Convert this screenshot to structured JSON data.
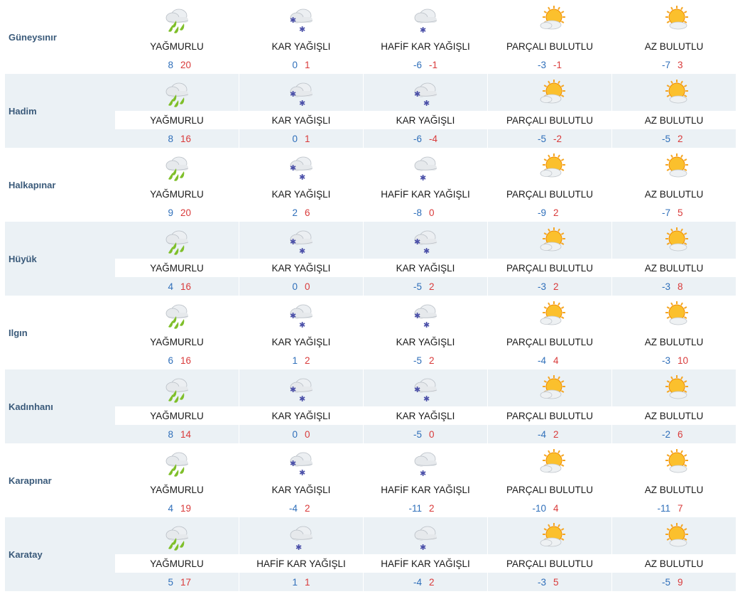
{
  "forecast": {
    "rows": [
      {
        "city": "Güneysınır",
        "days": [
          {
            "icon": "rain-icon",
            "condition": "YAĞMURLU",
            "min": "8",
            "max": "20"
          },
          {
            "icon": "snow-icon",
            "condition": "KAR YAĞIŞLI",
            "min": "0",
            "max": "1"
          },
          {
            "icon": "light-snow-icon",
            "condition": "HAFİF KAR YAĞIŞLI",
            "min": "-6",
            "max": "-1"
          },
          {
            "icon": "partly-cloudy-icon",
            "condition": "PARÇALI BULUTLU",
            "min": "-3",
            "max": "-1"
          },
          {
            "icon": "mostly-sunny-icon",
            "condition": "AZ BULUTLU",
            "min": "-7",
            "max": "3"
          }
        ]
      },
      {
        "city": "Hadim",
        "days": [
          {
            "icon": "rain-icon",
            "condition": "YAĞMURLU",
            "min": "8",
            "max": "16"
          },
          {
            "icon": "snow-icon",
            "condition": "KAR YAĞIŞLI",
            "min": "0",
            "max": "1"
          },
          {
            "icon": "snow-icon",
            "condition": "KAR YAĞIŞLI",
            "min": "-6",
            "max": "-4"
          },
          {
            "icon": "partly-cloudy-icon",
            "condition": "PARÇALI BULUTLU",
            "min": "-5",
            "max": "-2"
          },
          {
            "icon": "mostly-sunny-icon",
            "condition": "AZ BULUTLU",
            "min": "-5",
            "max": "2"
          }
        ]
      },
      {
        "city": "Halkapınar",
        "days": [
          {
            "icon": "rain-icon",
            "condition": "YAĞMURLU",
            "min": "9",
            "max": "20"
          },
          {
            "icon": "snow-icon",
            "condition": "KAR YAĞIŞLI",
            "min": "2",
            "max": "6"
          },
          {
            "icon": "light-snow-icon",
            "condition": "HAFİF KAR YAĞIŞLI",
            "min": "-8",
            "max": "0"
          },
          {
            "icon": "partly-cloudy-icon",
            "condition": "PARÇALI BULUTLU",
            "min": "-9",
            "max": "2"
          },
          {
            "icon": "mostly-sunny-icon",
            "condition": "AZ BULUTLU",
            "min": "-7",
            "max": "5"
          }
        ]
      },
      {
        "city": "Hüyük",
        "days": [
          {
            "icon": "rain-icon",
            "condition": "YAĞMURLU",
            "min": "4",
            "max": "16"
          },
          {
            "icon": "snow-icon",
            "condition": "KAR YAĞIŞLI",
            "min": "0",
            "max": "0"
          },
          {
            "icon": "snow-icon",
            "condition": "KAR YAĞIŞLI",
            "min": "-5",
            "max": "2"
          },
          {
            "icon": "partly-cloudy-icon",
            "condition": "PARÇALI BULUTLU",
            "min": "-3",
            "max": "2"
          },
          {
            "icon": "mostly-sunny-icon",
            "condition": "AZ BULUTLU",
            "min": "-3",
            "max": "8"
          }
        ]
      },
      {
        "city": "Ilgın",
        "days": [
          {
            "icon": "rain-icon",
            "condition": "YAĞMURLU",
            "min": "6",
            "max": "16"
          },
          {
            "icon": "snow-icon",
            "condition": "KAR YAĞIŞLI",
            "min": "1",
            "max": "2"
          },
          {
            "icon": "snow-icon",
            "condition": "KAR YAĞIŞLI",
            "min": "-5",
            "max": "2"
          },
          {
            "icon": "partly-cloudy-icon",
            "condition": "PARÇALI BULUTLU",
            "min": "-4",
            "max": "4"
          },
          {
            "icon": "mostly-sunny-icon",
            "condition": "AZ BULUTLU",
            "min": "-3",
            "max": "10"
          }
        ]
      },
      {
        "city": "Kadınhanı",
        "days": [
          {
            "icon": "rain-icon",
            "condition": "YAĞMURLU",
            "min": "8",
            "max": "14"
          },
          {
            "icon": "snow-icon",
            "condition": "KAR YAĞIŞLI",
            "min": "0",
            "max": "0"
          },
          {
            "icon": "snow-icon",
            "condition": "KAR YAĞIŞLI",
            "min": "-5",
            "max": "0"
          },
          {
            "icon": "partly-cloudy-icon",
            "condition": "PARÇALI BULUTLU",
            "min": "-4",
            "max": "2"
          },
          {
            "icon": "mostly-sunny-icon",
            "condition": "AZ BULUTLU",
            "min": "-2",
            "max": "6"
          }
        ]
      },
      {
        "city": "Karapınar",
        "days": [
          {
            "icon": "rain-icon",
            "condition": "YAĞMURLU",
            "min": "4",
            "max": "19"
          },
          {
            "icon": "snow-icon",
            "condition": "KAR YAĞIŞLI",
            "min": "-4",
            "max": "2"
          },
          {
            "icon": "light-snow-icon",
            "condition": "HAFİF KAR YAĞIŞLI",
            "min": "-11",
            "max": "2"
          },
          {
            "icon": "partly-cloudy-icon",
            "condition": "PARÇALI BULUTLU",
            "min": "-10",
            "max": "4"
          },
          {
            "icon": "mostly-sunny-icon",
            "condition": "AZ BULUTLU",
            "min": "-11",
            "max": "7"
          }
        ]
      },
      {
        "city": "Karatay",
        "days": [
          {
            "icon": "rain-icon",
            "condition": "YAĞMURLU",
            "min": "5",
            "max": "17"
          },
          {
            "icon": "light-snow-icon",
            "condition": "HAFİF KAR YAĞIŞLI",
            "min": "1",
            "max": "1"
          },
          {
            "icon": "light-snow-icon",
            "condition": "HAFİF KAR YAĞIŞLI",
            "min": "-4",
            "max": "2"
          },
          {
            "icon": "partly-cloudy-icon",
            "condition": "PARÇALI BULUTLU",
            "min": "-3",
            "max": "5"
          },
          {
            "icon": "mostly-sunny-icon",
            "condition": "AZ BULUTLU",
            "min": "-5",
            "max": "9"
          }
        ]
      }
    ]
  },
  "colors": {
    "city_text": "#3a5a7a",
    "min_temp": "#2f6fba",
    "max_temp": "#d93a3a",
    "shade": "#ebf1f5",
    "rain_drop": "#7fbf2a",
    "snowflake": "#4a4fa8",
    "sun": "#f5a623"
  }
}
